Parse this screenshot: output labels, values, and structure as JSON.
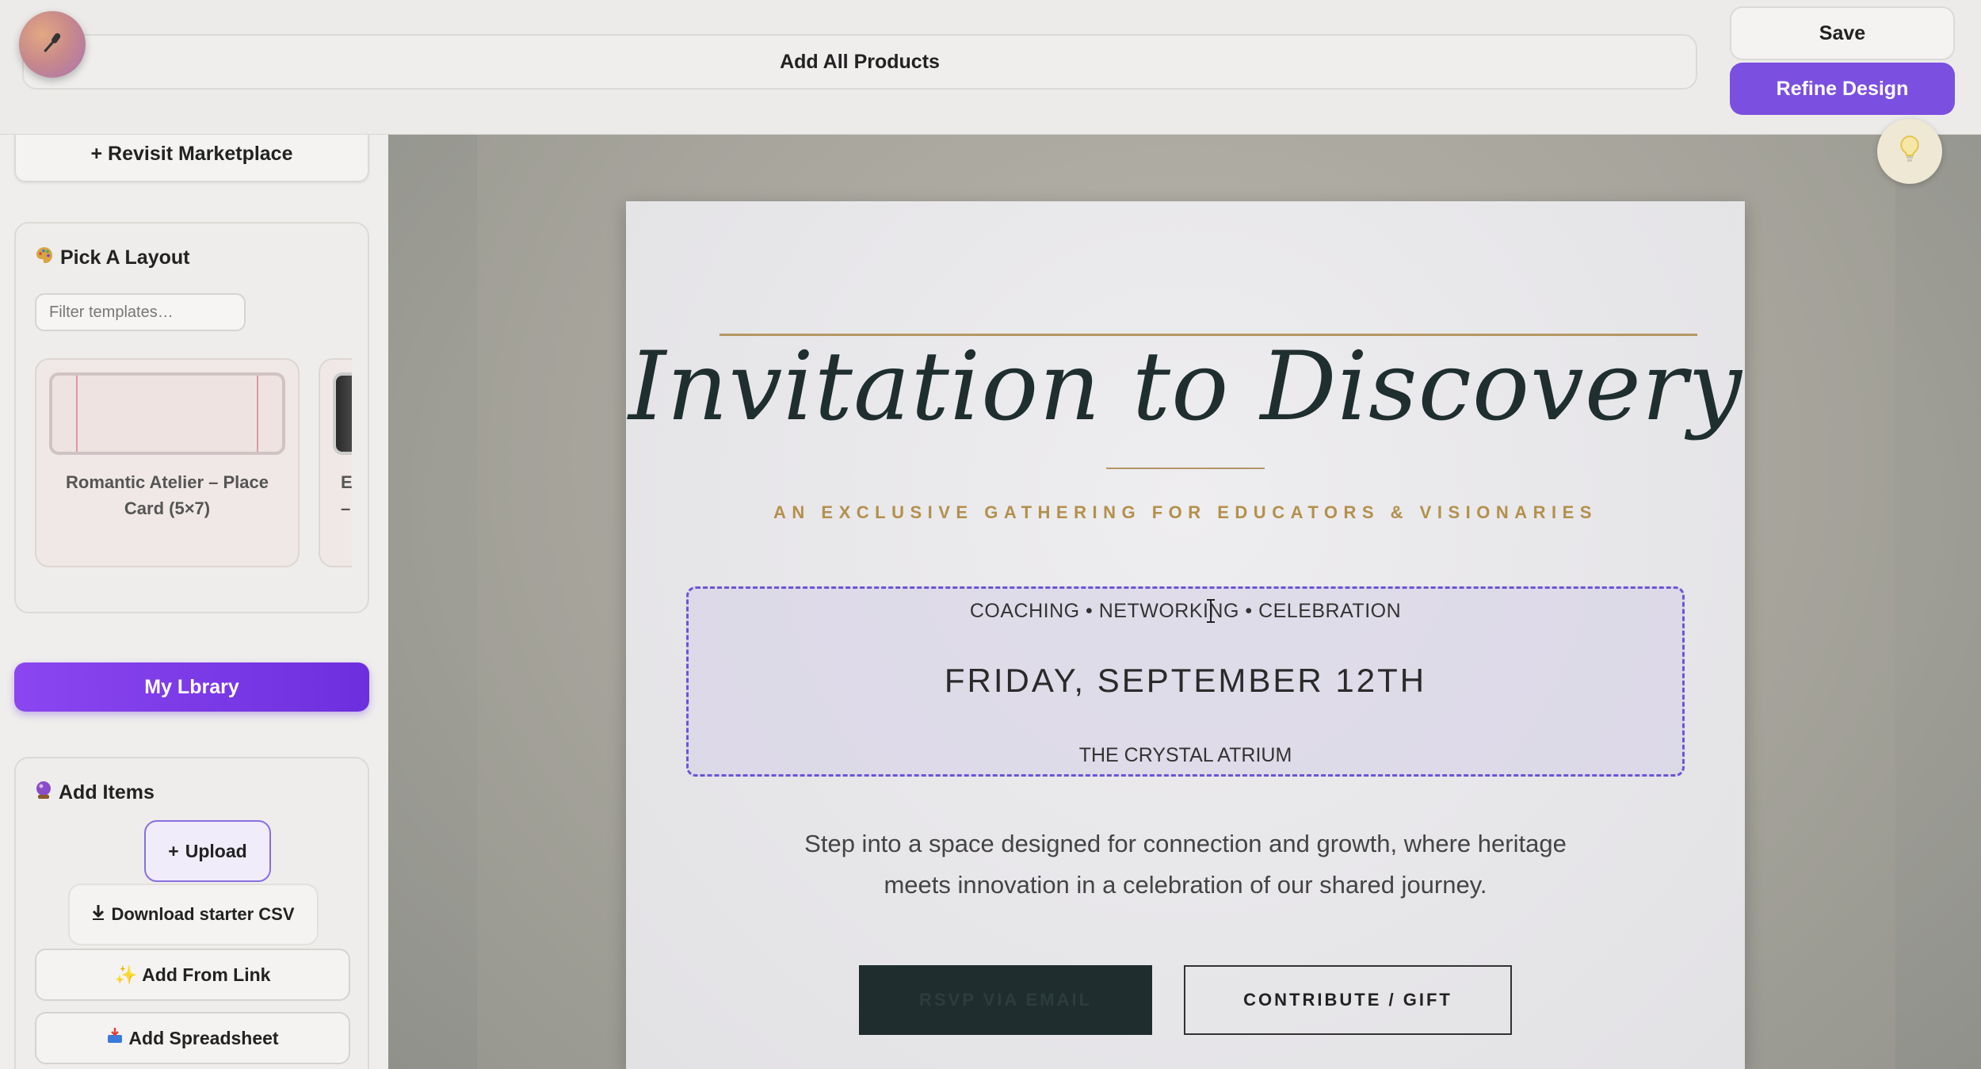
{
  "topbar": {
    "prompt_label": "Add All Products",
    "save_label": "Save",
    "refine_label": "Refine Design",
    "mic_icon": "microphone-icon"
  },
  "sidebar": {
    "revisit_label": "+ Revisit Marketplace",
    "layout": {
      "title": "Pick A Layout",
      "icon": "palette-icon",
      "filter_placeholder": "Filter templates…",
      "templates": [
        {
          "label": "Romantic Atelier – Place Card (5×7)"
        },
        {
          "label": "E\n–"
        }
      ]
    },
    "library_label": "My Lbrary",
    "add_items": {
      "title": "Add Items",
      "icon": "crystal-ball-icon",
      "upload_label": "Upload",
      "csv_label": "Download starter CSV",
      "link_label": "Add From Link",
      "spreadsheet_label": "Add Spreadsheet"
    }
  },
  "invitation": {
    "title": "Invitation to Discovery",
    "subtitle": "AN EXCLUSIVE GATHERING FOR EDUCATORS & VISIONARIES",
    "tags": "COACHING • NETWORKING • CELEBRATION",
    "date": "FRIDAY, SEPTEMBER 12TH",
    "venue": "THE CRYSTAL ATRIUM",
    "body": "Step into a space designed for connection and growth, where heritage meets innovation in a celebration of our shared journey.",
    "rsvp_label": "RSVP VIA EMAIL",
    "contribute_label": "CONTRIBUTE / GIFT"
  },
  "colors": {
    "accent": "#7b4fe0",
    "gold": "#b3904c",
    "dark_teal": "#1f2d2e"
  }
}
